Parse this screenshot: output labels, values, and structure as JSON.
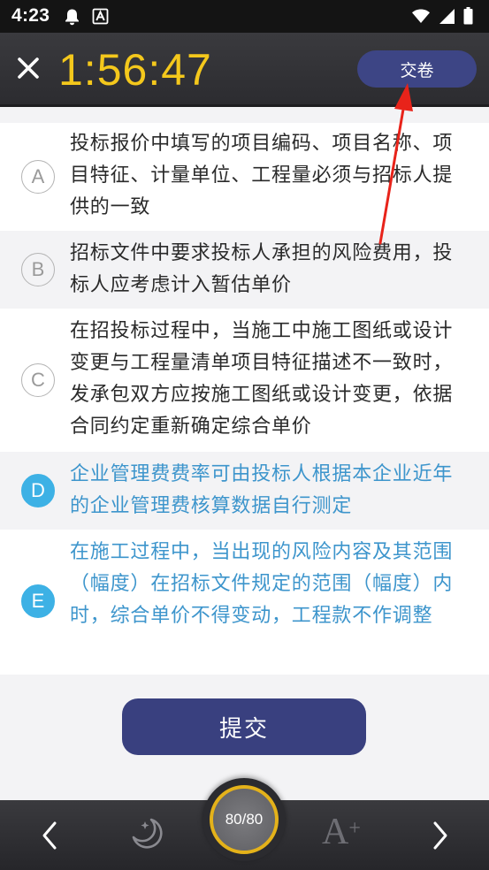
{
  "status_bar": {
    "time": "4:23"
  },
  "header": {
    "timer": "1:56:47",
    "submit_label": "交卷"
  },
  "options": [
    {
      "letter": "A",
      "text": "投标报价中填写的项目编码、项目名称、项目特征、计量单位、工程量必须与招标人提供的一致",
      "selected": false
    },
    {
      "letter": "B",
      "text": "招标文件中要求投标人承担的风险费用，投标人应考虑计入暂估单价",
      "selected": false
    },
    {
      "letter": "C",
      "text": "在招投标过程中，当施工中施工图纸或设计变更与工程量清单项目特征描述不一致时，发承包双方应按施工图纸或设计变更，依据合同约定重新确定综合单价",
      "selected": false
    },
    {
      "letter": "D",
      "text": "企业管理费费率可由投标人根据本企业近年的企业管理费核算数据自行测定",
      "selected": true
    },
    {
      "letter": "E",
      "text": "在施工过程中，当出现的风险内容及其范围（幅度）在招标文件规定的范围（幅度）内时，综合单价不得变动，工程款不作调整",
      "selected": true
    }
  ],
  "submit_button": "提交",
  "bottom_bar": {
    "counter": "80/80",
    "font_size_label": "A",
    "font_size_plus": "+"
  },
  "colors": {
    "timer": "#f4c81c",
    "accent_blue": "#3db1e5",
    "selected_text": "#3d95cc",
    "button_navy": "#39407f",
    "annotation_red": "#e8231a",
    "counter_ring": "#e4b21a"
  }
}
